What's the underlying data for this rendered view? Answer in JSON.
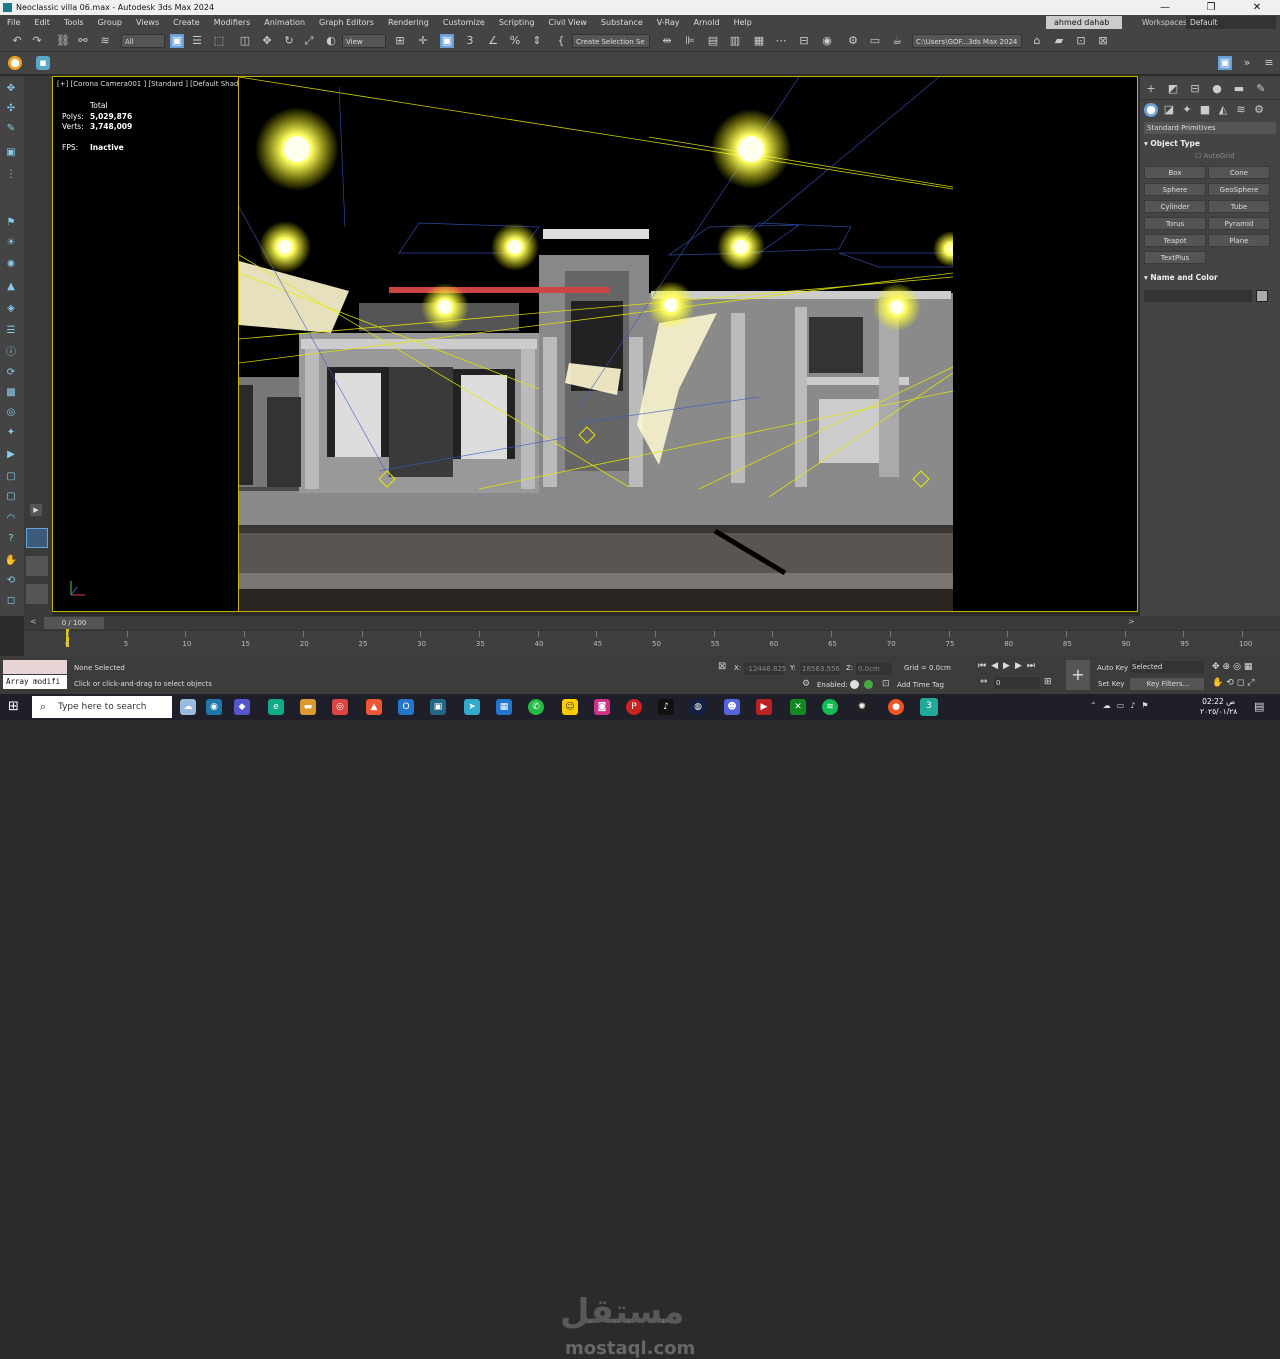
{
  "window": {
    "title": "Neoclassic villa 06.max - Autodesk 3ds Max 2024",
    "user": "ahmed dahab",
    "workspaces_label": "Workspaces:",
    "workspaces_value": "Default"
  },
  "menu": [
    "File",
    "Edit",
    "Tools",
    "Group",
    "Views",
    "Create",
    "Modifiers",
    "Animation",
    "Graph Editors",
    "Rendering",
    "Customize",
    "Scripting",
    "Civil View",
    "Substance",
    "V-Ray",
    "Arnold",
    "Help"
  ],
  "toolbar": {
    "filter": "All",
    "ref_coord": "View",
    "selection_set": "Create Selection Se",
    "path": "C:\\Users\\GOF...3ds Max 2024"
  },
  "viewport": {
    "label": "[+] [Corona Camera001 ] [Standard ] [Default Shading ]",
    "stats_total": "Total",
    "polys_label": "Polys:",
    "polys_value": "5,029,876",
    "verts_label": "Verts:",
    "verts_value": "3,748,009",
    "fps_label": "FPS:",
    "fps_value": "Inactive"
  },
  "command_panel": {
    "dropdown": "Standard Primitives",
    "object_type_header": "Object Type",
    "autogrid": "AutoGrid",
    "buttons": [
      "Box",
      "Cone",
      "Sphere",
      "GeoSphere",
      "Cylinder",
      "Tube",
      "Torus",
      "Pyramid",
      "Teapot",
      "Plane",
      "TextPlus"
    ],
    "name_color_header": "Name and Color"
  },
  "timeline": {
    "frame": "0 / 100",
    "ticks": [
      "0",
      "5",
      "10",
      "15",
      "20",
      "25",
      "30",
      "35",
      "40",
      "45",
      "50",
      "55",
      "60",
      "65",
      "70",
      "75",
      "80",
      "85",
      "90",
      "95",
      "100"
    ]
  },
  "status": {
    "script_text": "Array modifi",
    "selection": "None Selected",
    "prompt": "Click or click-and-drag to select objects",
    "x_label": "X:",
    "x_value": "-12446.825",
    "y_label": "Y:",
    "y_value": "18563.556",
    "z_label": "Z:",
    "z_value": "0.0cm",
    "grid": "Grid = 0.0cm",
    "enabled": "Enabled:",
    "add_time_tag": "Add Time Tag",
    "frame_field": "0",
    "auto_key": "Auto Key",
    "set_key": "Set Key",
    "key_mode": "Selected",
    "key_filters": "Key Filters..."
  },
  "taskbar": {
    "search_placeholder": "Type here to search",
    "time": "02:22 ص",
    "date": "٢٠٢٥/٠١/٢٨"
  },
  "watermark": {
    "arabic": "مستقل",
    "latin": "mostaql.com"
  },
  "colors": {
    "viewport_border": "#c8b400",
    "light_glow": "#ffff66",
    "light_rays": "#e8e800"
  }
}
